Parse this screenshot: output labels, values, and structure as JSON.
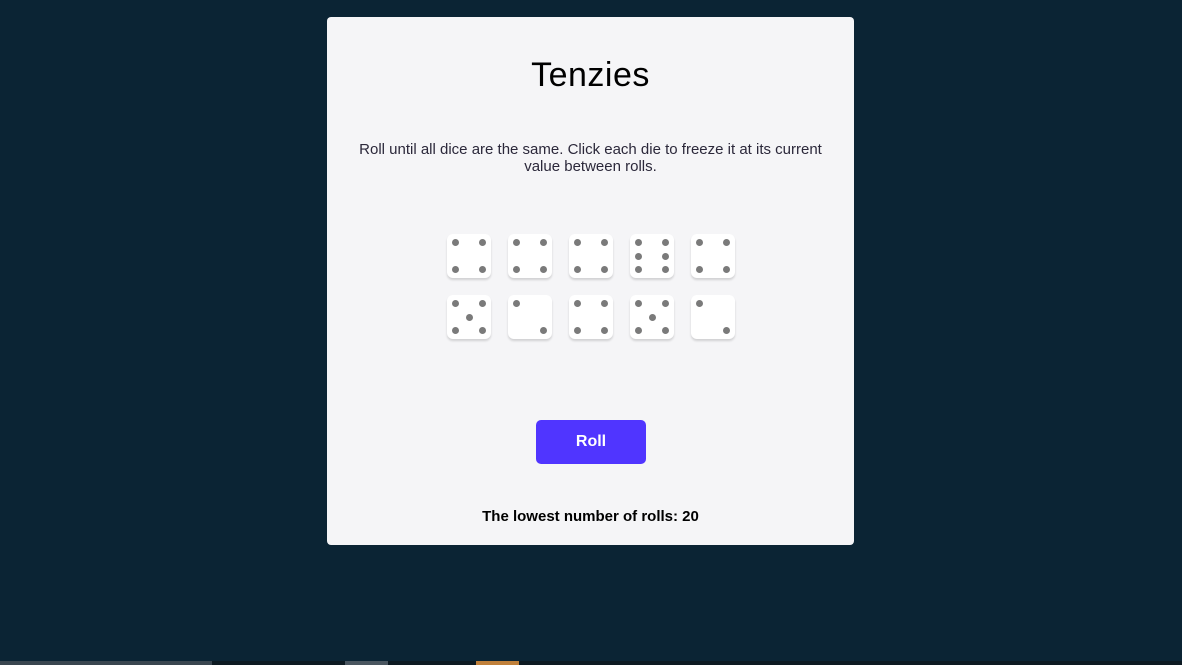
{
  "game": {
    "title": "Tenzies",
    "instructions": "Roll until all dice are the same. Click each die to freeze it at its current value between rolls.",
    "dice": [
      4,
      4,
      4,
      6,
      4,
      5,
      2,
      4,
      5,
      2
    ],
    "roll_label": "Roll",
    "record_label": "The lowest number of rolls: 20"
  },
  "colors": {
    "background": "#0b2434",
    "card": "#f5f5f7",
    "accent": "#5035ff",
    "pip": "#7a7a7a"
  }
}
